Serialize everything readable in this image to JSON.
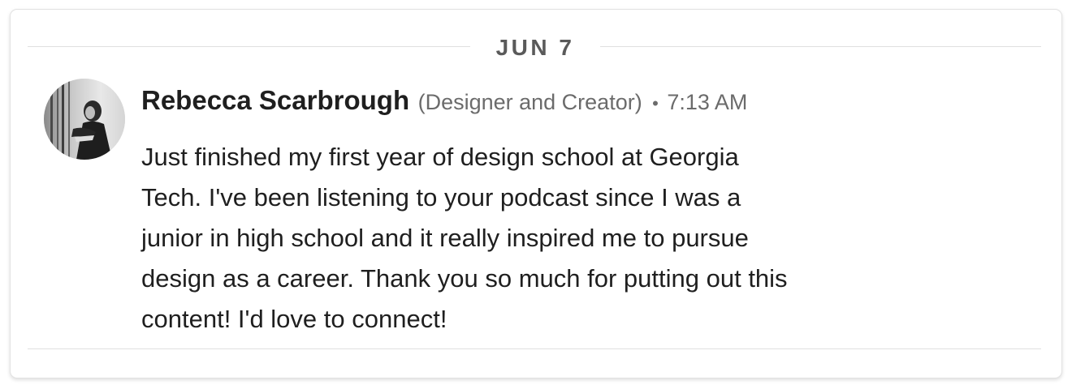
{
  "date_divider": {
    "label": "JUN 7"
  },
  "message": {
    "avatar_icon": "profile-photo",
    "author_name": "Rebecca Scarbrough",
    "author_role": "(Designer and Creator)",
    "separator": "•",
    "timestamp": "7:13 AM",
    "lines": [
      "Just finished my first year of design school at Georgia",
      "Tech. I've been listening to your podcast since I was a",
      "junior in high school and it really inspired me to pursue",
      "design as a career. Thank you so much for putting out this",
      "content! I'd love to connect!"
    ]
  }
}
